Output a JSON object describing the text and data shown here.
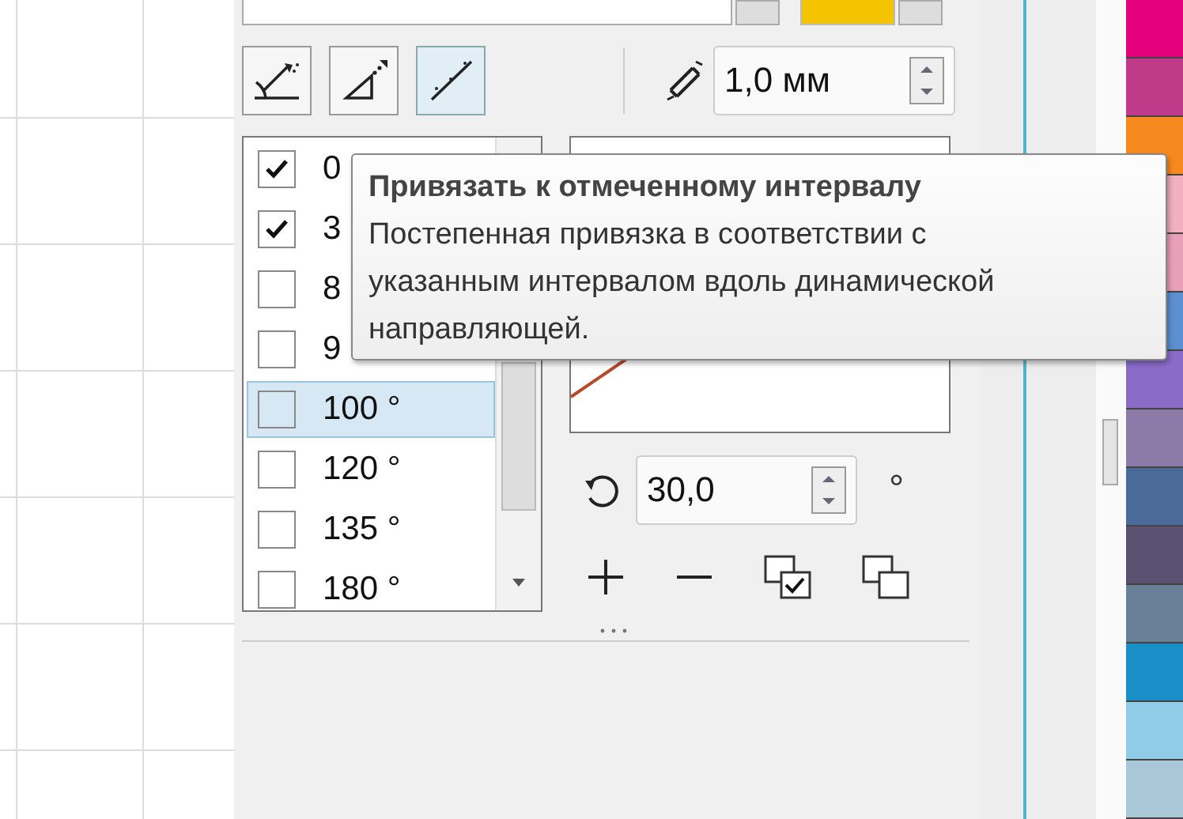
{
  "toolbar": {
    "buttons": [
      {
        "kind": "angle",
        "selected": false
      },
      {
        "kind": "triangle",
        "selected": false
      },
      {
        "kind": "line",
        "selected": true
      }
    ],
    "offset": {
      "value": "1,0 мм"
    }
  },
  "angles": [
    {
      "label": "0",
      "checked": true,
      "selected": false
    },
    {
      "label": "3",
      "checked": true,
      "selected": false
    },
    {
      "label": "8",
      "checked": false,
      "selected": false
    },
    {
      "label": "9",
      "checked": false,
      "selected": false
    },
    {
      "label": "100 °",
      "checked": false,
      "selected": true
    },
    {
      "label": "120 °",
      "checked": false,
      "selected": false
    },
    {
      "label": "135 °",
      "checked": false,
      "selected": false
    },
    {
      "label": "180 °",
      "checked": false,
      "selected": false
    }
  ],
  "rotation": {
    "value": "30,0",
    "unit": "°"
  },
  "tooltip": {
    "title": "Привязать к отмеченному интервалу",
    "text": "Постепенная привязка в соответствии с\nуказанным интервалом вдоль динамической\nнаправляющей."
  },
  "palette": [
    {
      "color": "#e5007e"
    },
    {
      "color": "#c03a8a"
    },
    {
      "color": "#f7891f"
    },
    {
      "color": "#f0b0c0"
    },
    {
      "color": "#e8a0b8"
    },
    {
      "color": "#5b8fd0"
    },
    {
      "color": "#8a6cc8"
    },
    {
      "color": "#8c7aa8"
    },
    {
      "color": "#4a6a98"
    },
    {
      "color": "#5a5070"
    },
    {
      "color": "#6a8098"
    },
    {
      "color": "#1a90c8"
    },
    {
      "color": "#90cce8"
    },
    {
      "color": "#a8c8d8"
    }
  ]
}
